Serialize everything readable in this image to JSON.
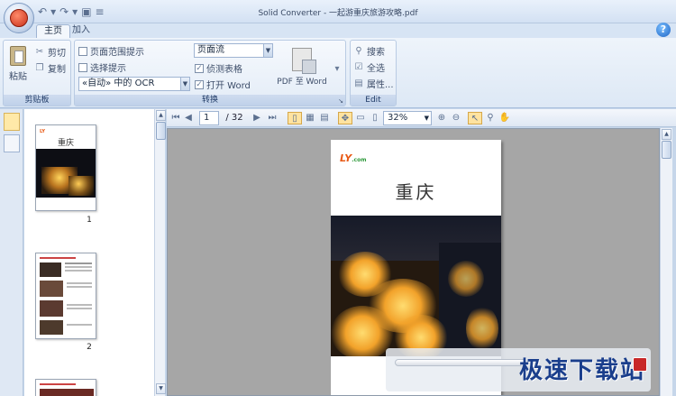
{
  "window": {
    "title": "Solid Converter - 一起游重庆旅游攻略.pdf"
  },
  "tabs": [
    {
      "label": "主页"
    },
    {
      "label": "加入"
    }
  ],
  "clipboard": {
    "paste_label": "粘贴",
    "cut_label": "剪切",
    "copy_label": "复制",
    "group_label": "剪贴板"
  },
  "convert": {
    "page_range_label": "页面范围提示",
    "select_label": "选择提示",
    "ocr_value": "«自动» 中的 OCR",
    "flow_value": "页面流",
    "detect_tables_label": "侦测表格",
    "open_word_label": "打开 Word",
    "pdf_to_word_label": "PDF 至 Word",
    "group_label": "转换"
  },
  "edit": {
    "search_label": "搜索",
    "select_all_label": "全选",
    "properties_label": "属性...",
    "group_label": "Edit"
  },
  "toolbar": {
    "page_current": "1",
    "page_total": "/ 32",
    "zoom_value": "32%"
  },
  "thumbnails": [
    {
      "number": "1",
      "title": "重庆"
    },
    {
      "number": "2",
      "title": ""
    }
  ],
  "document": {
    "logo_text": "LY",
    "logo_sub": ".com",
    "title": "重庆"
  },
  "watermark": {
    "text": "极速下载站"
  }
}
